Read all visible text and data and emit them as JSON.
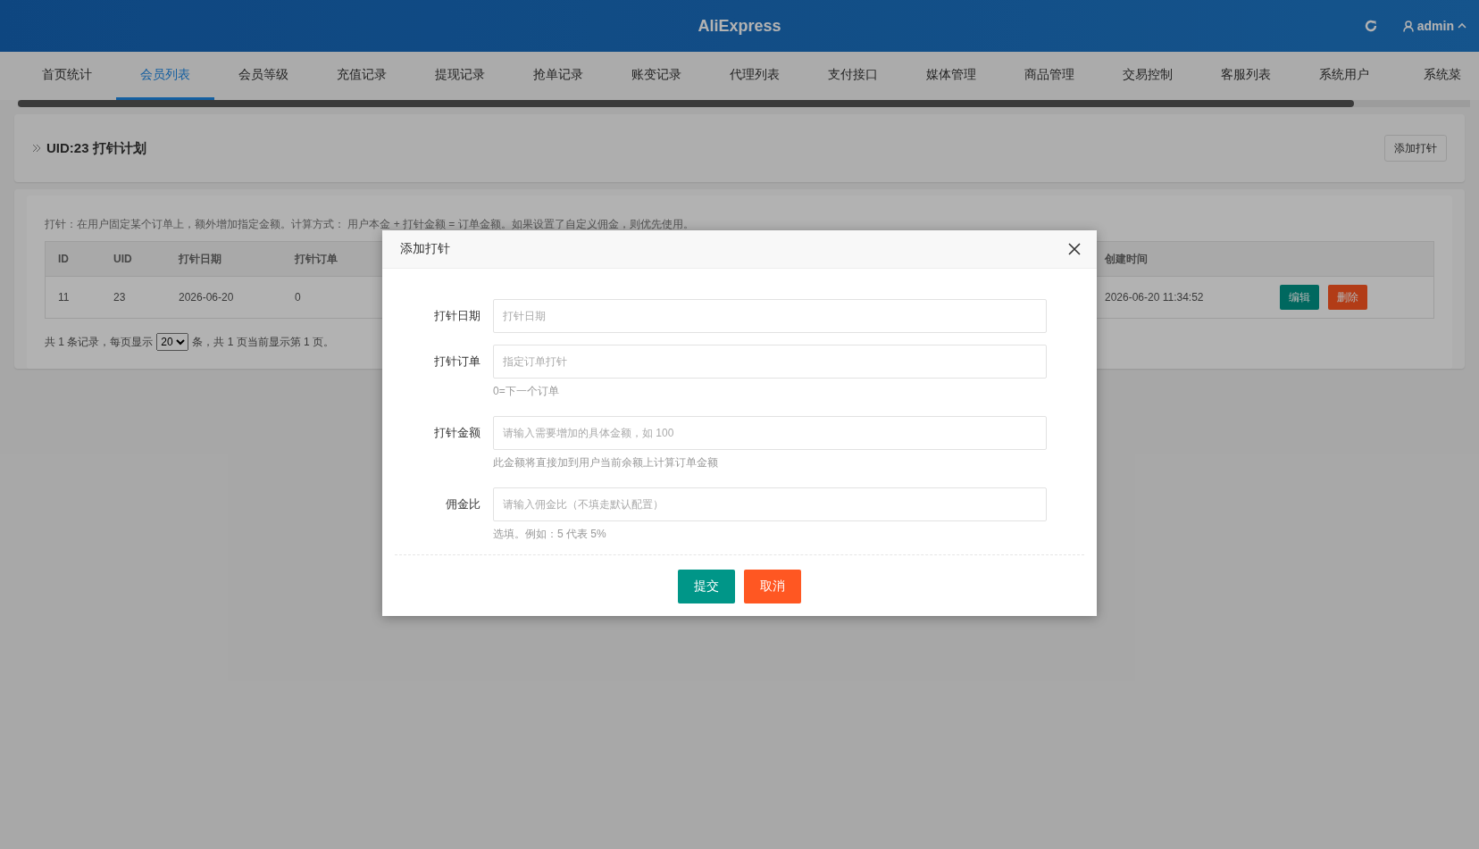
{
  "header": {
    "title": "AliExpress",
    "user": "admin"
  },
  "nav": [
    {
      "label": "首页统计",
      "selected": false
    },
    {
      "label": "会员列表",
      "selected": true
    },
    {
      "label": "会员等级",
      "selected": false
    },
    {
      "label": "充值记录",
      "selected": false
    },
    {
      "label": "提现记录",
      "selected": false
    },
    {
      "label": "抢单记录",
      "selected": false
    },
    {
      "label": "账变记录",
      "selected": false
    },
    {
      "label": "代理列表",
      "selected": false
    },
    {
      "label": "支付接口",
      "selected": false
    },
    {
      "label": "媒体管理",
      "selected": false
    },
    {
      "label": "商品管理",
      "selected": false
    },
    {
      "label": "交易控制",
      "selected": false
    },
    {
      "label": "客服列表",
      "selected": false
    },
    {
      "label": "系统用户",
      "selected": false
    },
    {
      "label": "系统菜",
      "selected": false
    }
  ],
  "page": {
    "title": "UID:23 打针计划",
    "button": "添加打针"
  },
  "notice": "打针：在用户固定某个订单上，额外增加指定金额。计算方式： 用户本金 + 打针金额 = 订单金额。如果设置了自定义佣金，则优先使用。",
  "table": {
    "columns": [
      "ID",
      "UID",
      "打针日期",
      "打针订单",
      "创建时间"
    ],
    "rows": [
      {
        "cells": [
          "11",
          "23",
          "2026-06-20",
          "0",
          "2026-06-20 11:34:52"
        ],
        "actions": [
          {
            "label": "编辑",
            "kind": "edit"
          },
          {
            "label": "删除",
            "kind": "delete"
          }
        ]
      }
    ]
  },
  "pagination": {
    "prefix": "共 1 条记录，每页显示",
    "page_size": "20",
    "suffix": "条，共 1 页当前显示第 1 页。"
  },
  "dialog": {
    "title": "添加打针",
    "fields": [
      {
        "label": "打针日期",
        "placeholder": "打针日期"
      },
      {
        "label": "打针订单",
        "placeholder": "指定订单打针",
        "hint": "0=下一个订单"
      },
      {
        "label": "打针金额",
        "placeholder": "请输入需要增加的具体金额，如 100",
        "hint": "此金额将直接加到用户当前余额上计算订单金额"
      },
      {
        "label": "佣金比",
        "placeholder": "请输入佣金比（不填走默认配置）",
        "hint": "选填。例如：5 代表 5%"
      }
    ],
    "buttons": [
      {
        "label": "提交",
        "kind": "primary"
      },
      {
        "label": "取消",
        "kind": "danger"
      }
    ]
  }
}
